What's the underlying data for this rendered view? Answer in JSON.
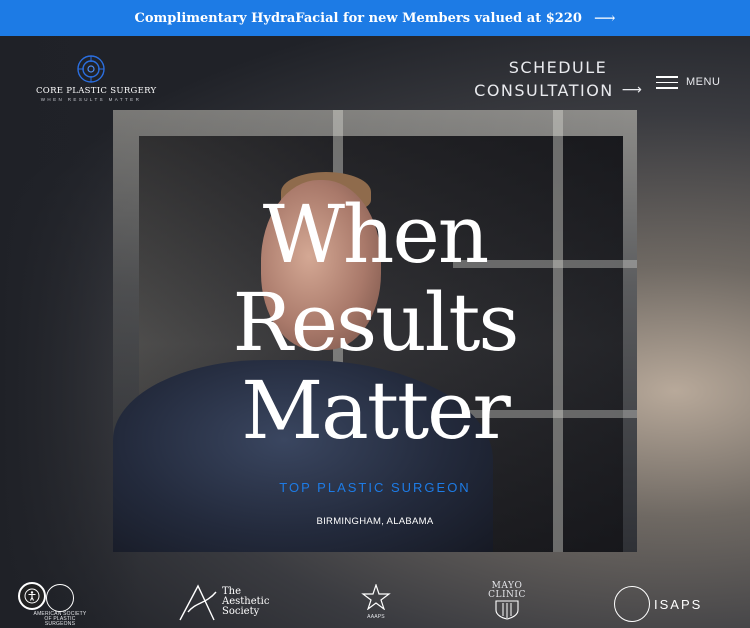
{
  "promo": {
    "text": "Complimentary HydraFacial for new Members valued at $220",
    "arrow_icon": "arrow-right-icon"
  },
  "header": {
    "logo_name": "CORE PLASTIC SURGERY",
    "logo_tagline": "WHEN RESULTS MATTER",
    "schedule_line1": "SCHEDULE",
    "schedule_line2": "CONSULTATION",
    "menu_label": "MENU"
  },
  "hero": {
    "headline_line1": "When",
    "headline_line2": "Results",
    "headline_line3": "Matter",
    "kicker": "TOP PLASTIC SURGEON",
    "location": "BIRMINGHAM, ALABAMA"
  },
  "affiliations": {
    "asps": "AMERICAN SOCIETY OF PLASTIC SURGEONS",
    "aesthetic_1": "The",
    "aesthetic_2": "Aesthetic",
    "aesthetic_3": "Society",
    "aaaps": "AAAPS",
    "mayo_1": "MAYO",
    "mayo_2": "CLINIC",
    "isaps": "ISAPS"
  },
  "colors": {
    "accent": "#1d7be5",
    "background": "#1b1d22",
    "text": "#ffffff"
  }
}
